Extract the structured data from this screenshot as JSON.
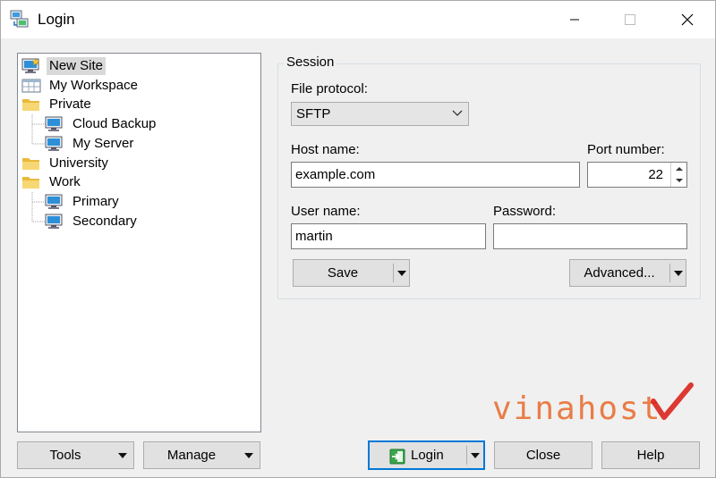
{
  "window": {
    "title": "Login"
  },
  "tree": {
    "items": [
      {
        "label": "New Site",
        "icon": "new-site-monitor-icon"
      },
      {
        "label": "My Workspace",
        "icon": "workspace-icon"
      },
      {
        "label": "Private",
        "icon": "folder-icon"
      },
      {
        "label": "Cloud Backup",
        "icon": "monitor-icon"
      },
      {
        "label": "My Server",
        "icon": "monitor-icon"
      },
      {
        "label": "University",
        "icon": "folder-icon"
      },
      {
        "label": "Work",
        "icon": "folder-icon"
      },
      {
        "label": "Primary",
        "icon": "monitor-icon"
      },
      {
        "label": "Secondary",
        "icon": "monitor-icon"
      }
    ],
    "selected": "New Site"
  },
  "session": {
    "legend": "Session",
    "file_protocol_label": "File protocol:",
    "file_protocol_value": "SFTP",
    "host_label": "Host name:",
    "host_value": "example.com",
    "port_label": "Port number:",
    "port_value": "22",
    "user_label": "User name:",
    "user_value": "martin",
    "password_label": "Password:",
    "password_value": "",
    "save_label": "Save",
    "advanced_label": "Advanced..."
  },
  "footer": {
    "tools_label": "Tools",
    "manage_label": "Manage",
    "login_label": "Login",
    "close_label": "Close",
    "help_label": "Help"
  },
  "watermark": {
    "text": "vinahost"
  },
  "colors": {
    "accent": "#0078d7",
    "watermark": "#e8682a",
    "check": "#d9251d"
  }
}
